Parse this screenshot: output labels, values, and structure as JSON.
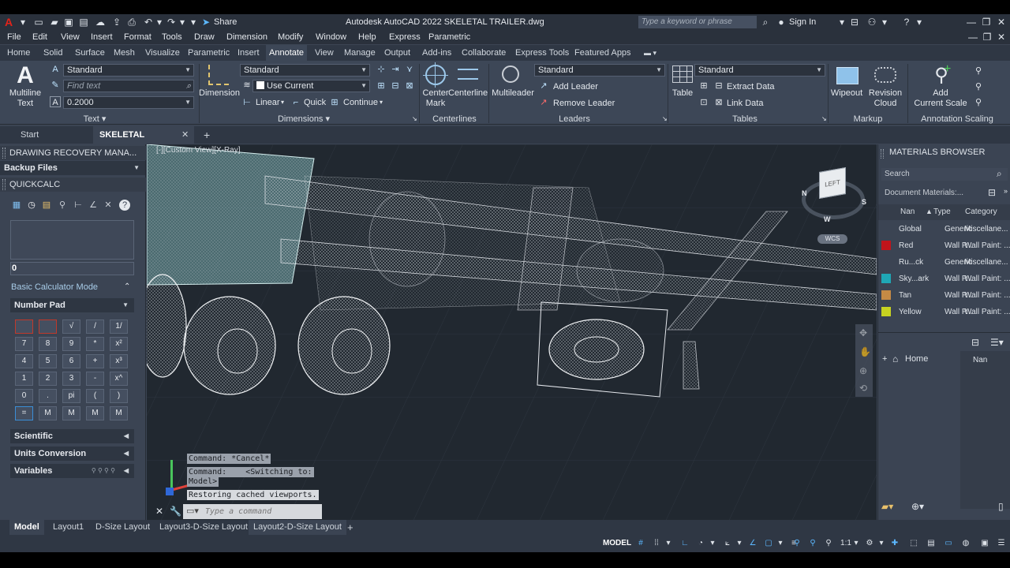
{
  "titlebar": {
    "app_letter": "A",
    "share_label": "Share",
    "title": "Autodesk AutoCAD 2022    SKELETAL TRAILER.dwg",
    "search_placeholder": "Type a keyword or phrase",
    "sign_in": "Sign In"
  },
  "menubar": {
    "items": [
      "File",
      "Edit",
      "View",
      "Insert",
      "Format",
      "Tools",
      "Draw",
      "Dimension",
      "Modify",
      "Window",
      "Help",
      "Express",
      "Parametric"
    ]
  },
  "ribbon_tabs": {
    "items": [
      "Home",
      "Solid",
      "Surface",
      "Mesh",
      "Visualize",
      "Parametric",
      "Insert",
      "Annotate",
      "View",
      "Manage",
      "Output",
      "Add-ins",
      "Collaborate",
      "Express Tools",
      "Featured Apps"
    ],
    "active": "Annotate"
  },
  "ribbon": {
    "text_panel": {
      "title": "Text",
      "multiline_line1": "Multiline",
      "multiline_line2": "Text",
      "style_value": "Standard",
      "find_placeholder": "Find text",
      "height_value": "0.2000"
    },
    "dimensions_panel": {
      "title": "Dimensions",
      "dimension_label": "Dimension",
      "style_value": "Standard",
      "layer_value": "Use Current",
      "linear": "Linear",
      "quick": "Quick",
      "continue": "Continue"
    },
    "centerlines_panel": {
      "title": "Centerlines",
      "center_mark_line1": "Center",
      "center_mark_line2": "Mark",
      "centerline": "Centerline"
    },
    "leaders_panel": {
      "title": "Leaders",
      "multileader": "Multileader",
      "style_value": "Standard",
      "add_leader": "Add Leader",
      "remove_leader": "Remove Leader"
    },
    "tables_panel": {
      "title": "Tables",
      "table": "Table",
      "style_value": "Standard",
      "extract_data": "Extract Data",
      "link_data": "Link Data"
    },
    "markup_panel": {
      "title": "Markup",
      "wipeout": "Wipeout",
      "revision_cloud_line1": "Revision",
      "revision_cloud_line2": "Cloud"
    },
    "annotation_scaling_panel": {
      "title": "Annotation Scaling",
      "add_scale_line1": "Add",
      "add_scale_line2": "Current Scale"
    }
  },
  "file_tabs": {
    "items": [
      "Start",
      "SKELETAL TRAILER*"
    ],
    "active": "SKELETAL TRAILER*"
  },
  "left_panel": {
    "recovery_title": "DRAWING RECOVERY MANA...",
    "backup_files": "Backup Files",
    "quickcalc_title": "QUICKCALC",
    "display_value": "0",
    "basic_mode": "Basic Calculator Mode",
    "number_pad": "Number Pad",
    "keys": [
      [
        "",
        "",
        "√",
        "/",
        "1/"
      ],
      [
        "7",
        "8",
        "9",
        "*",
        "x²"
      ],
      [
        "4",
        "5",
        "6",
        "+",
        "x³"
      ],
      [
        "1",
        "2",
        "3",
        "-",
        "x^"
      ],
      [
        "0",
        ".",
        "pi",
        "(",
        ")"
      ],
      [
        "=",
        "M",
        "M",
        "M",
        "M"
      ]
    ],
    "scientific": "Scientific",
    "units_conversion": "Units Conversion",
    "variables": "Variables"
  },
  "viewport": {
    "label": "[-][Custom View][X-Ray]",
    "viewcube_face": "LEFT",
    "wcs": "WCS",
    "compass_n": "N",
    "compass_s": "S",
    "compass_w": "W"
  },
  "command": {
    "history": [
      "Command: *Cancel*",
      "Command:    <Switching to:",
      "Model>",
      "Restoring cached viewports."
    ],
    "placeholder": "Type a command"
  },
  "right_panel": {
    "title": "MATERIALS BROWSER",
    "search_placeholder": "Search",
    "doc_materials": "Document Materials:...",
    "headers": [
      "Nan",
      "Type",
      "Category"
    ],
    "rows": [
      {
        "name": "Global",
        "type": "Generic",
        "category": "Miscellane...",
        "color": ""
      },
      {
        "name": "Red",
        "type": "Wall P...",
        "category": "Wall Paint: ...",
        "color": "#c0141b"
      },
      {
        "name": "Ru...ck",
        "type": "Generic",
        "category": "Miscellane...",
        "color": ""
      },
      {
        "name": "Sky...ark",
        "type": "Wall P...",
        "category": "Wall Paint: ...",
        "color": "#1fa7b5"
      },
      {
        "name": "Tan",
        "type": "Wall P...",
        "category": "Wall Paint: ...",
        "color": "#c58a45"
      },
      {
        "name": "Yellow",
        "type": "Wall P...",
        "category": "Wall Paint: ...",
        "color": "#c7d321"
      }
    ],
    "home": "Home",
    "home_col": "Nan"
  },
  "layout_tabs": {
    "items": [
      "Model",
      "Layout1",
      "D-Size Layout",
      "Layout3-D-Size Layout",
      "Layout2-D-Size Layout"
    ],
    "active": "Model"
  },
  "statusbar": {
    "model": "MODEL",
    "scale": "1:1"
  }
}
